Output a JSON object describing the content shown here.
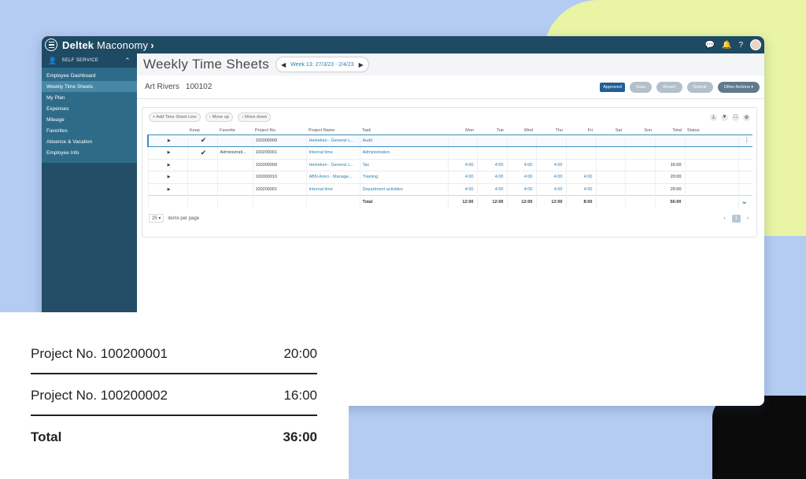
{
  "app": {
    "brand_bold": "Deltek",
    "brand_light": "Maconomy"
  },
  "topbar_icons": [
    "chat-icon",
    "bell-icon",
    "help-icon",
    "avatar"
  ],
  "sidebar": {
    "header": "SELF SERVICE",
    "items": [
      {
        "label": "Employee Dashboard",
        "active": false
      },
      {
        "label": "Weekly Time Sheets",
        "active": true
      },
      {
        "label": "My Plan",
        "active": false
      },
      {
        "label": "Expenses",
        "active": false
      },
      {
        "label": "Mileage",
        "active": false
      },
      {
        "label": "Favorites",
        "active": false
      },
      {
        "label": "Absence & Vacation",
        "active": false
      },
      {
        "label": "Employee Info",
        "active": false
      }
    ]
  },
  "page": {
    "title": "Weekly Time Sheets",
    "week": "Week 13: 27/3/23 - 2/4/23"
  },
  "employee": {
    "name": "Art Rivers",
    "id": "100102"
  },
  "actions": {
    "status": "Approved",
    "save": "Save",
    "revert": "Revert",
    "submit": "Submit",
    "other": "Other Actions"
  },
  "toolbar": {
    "add": "+ Add Time Sheet Line",
    "move_up": "↑ Move up",
    "move_down": "↓ Move down"
  },
  "table": {
    "columns": [
      "Keep",
      "Favorite",
      "Project No.",
      "Project Name",
      "Task",
      "Mon",
      "Tue",
      "Wed",
      "Thu",
      "Fri",
      "Sat",
      "Sun",
      "Total",
      "Status"
    ],
    "rows": [
      {
        "keep": true,
        "favorite": "",
        "project_no": "100300009",
        "project_name": "Heineken - General c...",
        "task": "Audit",
        "days": [
          "",
          "",
          "",
          "",
          "",
          "",
          ""
        ],
        "total": ""
      },
      {
        "keep": true,
        "favorite": "Administrati...",
        "project_no": "100200001",
        "project_name": "Internal time",
        "task": "Administration",
        "days": [
          "",
          "",
          "",
          "",
          "",
          "",
          ""
        ],
        "total": ""
      },
      {
        "keep": false,
        "favorite": "",
        "project_no": "100300009",
        "project_name": "Heineken - General c...",
        "task": "Tax",
        "days": [
          "4:00",
          "4:00",
          "4:00",
          "4:00",
          "",
          "",
          ""
        ],
        "total": "16:00"
      },
      {
        "keep": false,
        "favorite": "",
        "project_no": "100300010",
        "project_name": "ABN Amro - Manage...",
        "task": "Training",
        "days": [
          "4:00",
          "4:00",
          "4:00",
          "4:00",
          "4:00",
          "",
          ""
        ],
        "total": "20:00"
      },
      {
        "keep": false,
        "favorite": "",
        "project_no": "100200001",
        "project_name": "Internal time",
        "task": "Department activities",
        "days": [
          "4:00",
          "4:00",
          "4:00",
          "4:00",
          "4:00",
          "",
          ""
        ],
        "total": "20:00"
      }
    ],
    "total_label": "Total",
    "totals": [
      "12:00",
      "12:00",
      "12:00",
      "12:00",
      "8:00",
      "",
      ""
    ],
    "grand_total": "56:00"
  },
  "pager": {
    "per_page": "25",
    "label": "items per page",
    "page": "1"
  },
  "summary": {
    "rows": [
      {
        "label": "Project No. 100200001",
        "value": "20:00"
      },
      {
        "label": "Project No. 100200002",
        "value": "16:00"
      }
    ],
    "total_label": "Total",
    "total_value": "36:00"
  }
}
